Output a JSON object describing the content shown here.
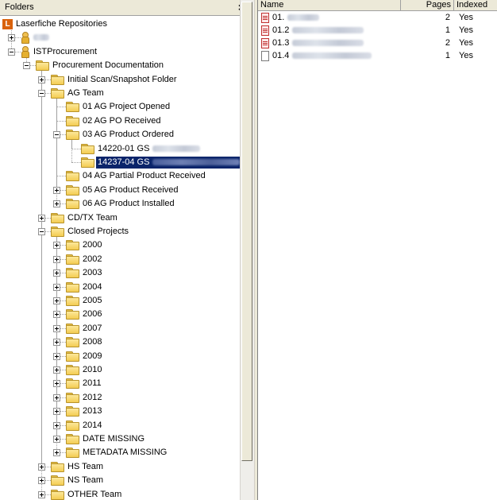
{
  "left_pane": {
    "title": "Folders",
    "close_glyph": "×"
  },
  "tree": {
    "root_label": "Laserfiche Repositories",
    "root_icon": "L",
    "user_repo_label": "",
    "ist_label": "ISTProcurement",
    "procurement_label": "Procurement Documentation",
    "initial_scan": "Initial Scan/Snapshot Folder",
    "ag_team": "AG Team",
    "ag_01": "01 AG Project Opened",
    "ag_02": "02 AG PO Received",
    "ag_03": "03 AG Product Ordered",
    "ag_03_a": "14220-01 GS",
    "ag_03_b": "14237-04 GS",
    "ag_04": "04 AG Partial Product Received",
    "ag_05": "05 AG Product Received",
    "ag_06": "06 AG Product Installed",
    "cdtx_team": "CD/TX Team",
    "closed_projects": "Closed Projects",
    "years": [
      "2000",
      "2002",
      "2003",
      "2004",
      "2005",
      "2006",
      "2007",
      "2008",
      "2009",
      "2010",
      "2011",
      "2012",
      "2013",
      "2014"
    ],
    "date_missing": "DATE MISSING",
    "metadata_missing": "METADATA MISSING",
    "hs_team": "HS Team",
    "ns_team": "NS Team",
    "other_team": "OTHER Team"
  },
  "list": {
    "columns": [
      "Name",
      "Pages",
      "Indexed"
    ],
    "rows": [
      {
        "name": "01.",
        "pages": "2",
        "indexed": "Yes",
        "icon": "pdf-icon"
      },
      {
        "name": "01.2",
        "pages": "1",
        "indexed": "Yes",
        "icon": "pdf-icon"
      },
      {
        "name": "01.3",
        "pages": "2",
        "indexed": "Yes",
        "icon": "pdf-icon"
      },
      {
        "name": "01.4",
        "pages": "1",
        "indexed": "Yes",
        "icon": "document-icon"
      }
    ]
  },
  "colors": {
    "selection": "#0a246a",
    "folder": "#f4cc52",
    "repository_icon": "#d9620c",
    "chrome": "#ece9d8"
  }
}
